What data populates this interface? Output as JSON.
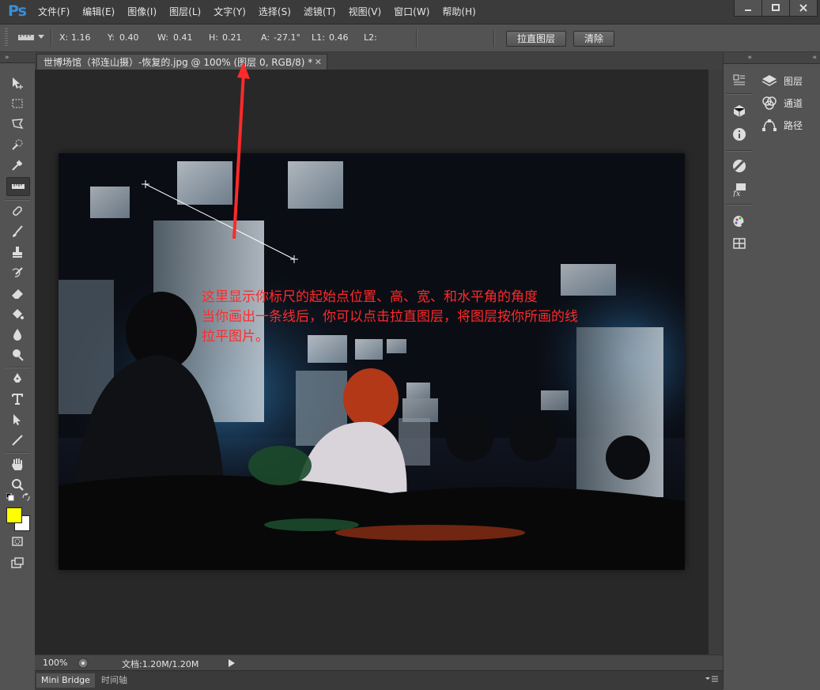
{
  "app": {
    "logo": "Ps"
  },
  "menu": [
    "文件(F)",
    "编辑(E)",
    "图像(I)",
    "图层(L)",
    "文字(Y)",
    "选择(S)",
    "滤镜(T)",
    "视图(V)",
    "窗口(W)",
    "帮助(H)"
  ],
  "window_controls": [
    "minimize-icon",
    "maximize-icon",
    "close-icon"
  ],
  "options": {
    "x_label": "X:",
    "x_value": "1.16",
    "y_label": "Y:",
    "y_value": "0.40",
    "w_label": "W:",
    "w_value": "0.41",
    "h_label": "H:",
    "h_value": "0.21",
    "a_label": "A:",
    "a_value": "-27.1°",
    "l1_label": "L1:",
    "l1_value": "0.46",
    "l2_label": "L2:",
    "straighten_button": "拉直图层",
    "clear_button": "清除"
  },
  "document": {
    "tab_title": "世博场馆（祁连山摄）-恢复的.jpg @ 100% (图层 0, RGB/8) *",
    "zoom": "100%",
    "doc_size": "文档:1.20M/1.20M"
  },
  "bottom_tabs": [
    "Mini Bridge",
    "时间轴"
  ],
  "tools": [
    "move-icon",
    "marquee-icon",
    "lasso-icon",
    "quick-select-icon",
    "eyedropper-icon",
    "ruler-icon",
    "healing-brush-icon",
    "brush-icon",
    "clone-stamp-icon",
    "history-brush-icon",
    "eraser-icon",
    "paint-bucket-icon",
    "blur-icon",
    "dodge-icon",
    "pen-icon",
    "type-icon",
    "path-select-icon",
    "line-icon",
    "hand-icon",
    "zoom-icon"
  ],
  "colors": {
    "foreground": "#ffff00",
    "background": "#ffffff",
    "annotation": "#ff2a2a",
    "logo": "#3a8fd6"
  },
  "panels": {
    "layers": "图层",
    "channels": "通道",
    "paths": "路径"
  },
  "annotation_lines": [
    "这里显示你标尺的起始点位置、高、宽、和水平角的角度",
    "当你画出一条线后，你可以点击拉直图层，将图层按你所画的线",
    "拉平图片。"
  ]
}
